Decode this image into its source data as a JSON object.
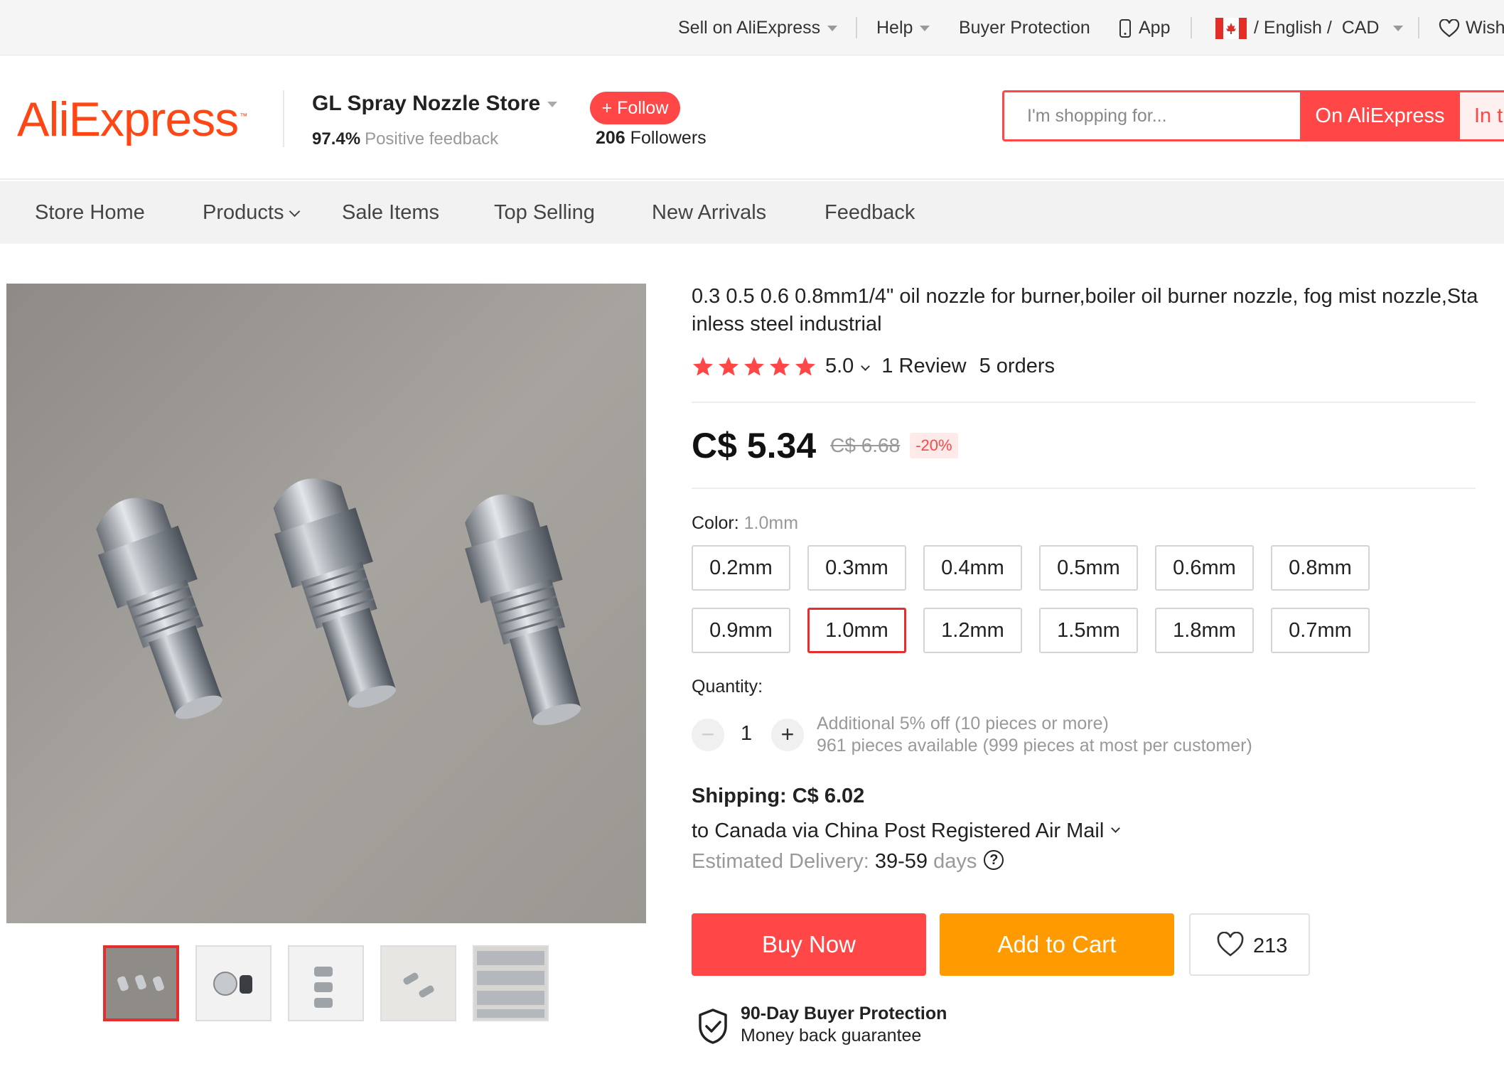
{
  "topbar": {
    "sell": "Sell on AliExpress",
    "help": "Help",
    "buyer_protection": "Buyer Protection",
    "app": "App",
    "language": "/ English /",
    "currency": "CAD",
    "wishlist": "Wish"
  },
  "header": {
    "logo_text": "AliExpress",
    "logo_tm": "™",
    "store_name": "GL Spray Nozzle Store",
    "feedback_pct": "97.4%",
    "feedback_label": "Positive feedback",
    "follow_label": "+ Follow",
    "followers_count": "206",
    "followers_label": "Followers",
    "search_placeholder": "I'm shopping for...",
    "search_btn_on": "On AliExpress",
    "search_btn_in": "In t"
  },
  "store_nav": [
    "Store Home",
    "Products",
    "Sale Items",
    "Top Selling",
    "New Arrivals",
    "Feedback"
  ],
  "product": {
    "title": "0.3 0.5 0.6 0.8mm1/4\" oil nozzle for burner,boiler oil burner nozzle, fog mist nozzle,Stainless steel industrial",
    "rating": "5.0",
    "stars": 5,
    "reviews": "1 Review",
    "orders": "5 orders",
    "price": "C$ 5.34",
    "old_price": "C$ 6.68",
    "discount": "-20%",
    "color_label": "Color:",
    "color_value": "1.0mm",
    "options": [
      "0.2mm",
      "0.3mm",
      "0.4mm",
      "0.5mm",
      "0.6mm",
      "0.8mm",
      "0.9mm",
      "1.0mm",
      "1.2mm",
      "1.5mm",
      "1.8mm",
      "0.7mm"
    ],
    "selected_option": "1.0mm",
    "quantity_label": "Quantity:",
    "quantity": "1",
    "qty_minus": "−",
    "qty_plus": "+",
    "qty_note_1": "Additional 5% off (10 pieces or more)",
    "qty_note_2": "961 pieces available (999 pieces at most per customer)",
    "shipping": "Shipping: C$ 6.02",
    "shipping_via": "to Canada via China Post Registered Air Mail",
    "est_label": "Estimated Delivery:",
    "est_value": "39-59",
    "est_unit": "days",
    "buy_now": "Buy Now",
    "add_to_cart": "Add to Cart",
    "wish_count": "213",
    "protection_title": "90-Day Buyer Protection",
    "protection_sub": "Money back guarantee"
  },
  "colors": {
    "accent": "#ff4747",
    "logo": "#ff4715",
    "cart": "#ff9a00",
    "star": "#ff4747"
  },
  "icons": [
    "caret-down-icon",
    "phone-icon",
    "canada-flag-icon",
    "heart-icon",
    "chevron-down-icon",
    "star-icon",
    "question-icon",
    "shield-check-icon"
  ]
}
